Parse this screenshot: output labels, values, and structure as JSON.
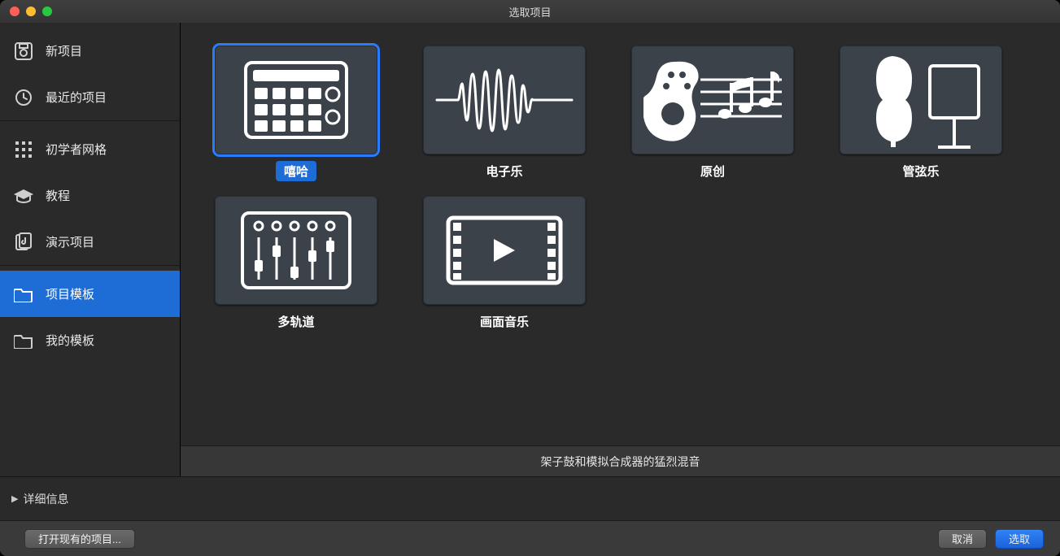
{
  "window": {
    "title": "选取项目"
  },
  "sidebar": {
    "items": [
      {
        "label": "新项目"
      },
      {
        "label": "最近的项目"
      },
      {
        "label": "初学者网格"
      },
      {
        "label": "教程"
      },
      {
        "label": "演示项目"
      },
      {
        "label": "项目模板"
      },
      {
        "label": "我的模板"
      }
    ]
  },
  "templates": [
    {
      "label": "嘻哈",
      "selected": true
    },
    {
      "label": "电子乐"
    },
    {
      "label": "原创"
    },
    {
      "label": "管弦乐"
    },
    {
      "label": "多轨道"
    },
    {
      "label": "画面音乐"
    }
  ],
  "description": "架子鼓和模拟合成器的猛烈混音",
  "detail": {
    "label": "详细信息"
  },
  "footer": {
    "open_label": "打开现有的项目...",
    "cancel_label": "取消",
    "choose_label": "选取"
  },
  "colors": {
    "accent": "#1e6dd6",
    "selection_ring": "#2a7cff",
    "panel": "#2a2a2a",
    "thumb": "#3b424a"
  }
}
